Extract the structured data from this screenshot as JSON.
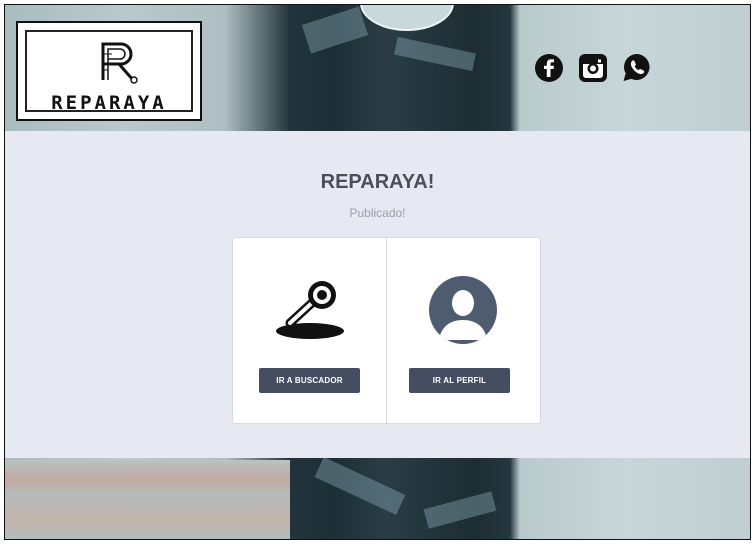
{
  "brand": {
    "logo_text": "REPARAYA"
  },
  "social": [
    {
      "name": "facebook-icon",
      "glyph": "f"
    },
    {
      "name": "instagram-icon",
      "glyph": ""
    },
    {
      "name": "whatsapp-icon",
      "glyph": ""
    }
  ],
  "main": {
    "title": "REPARAYA!",
    "subtitle": "Publicado!"
  },
  "cards": {
    "search_button": "IR A BUSCADOR",
    "profile_button": "IR AL PERFIL"
  },
  "colors": {
    "panel_bg": "#e7e9f2",
    "button_bg": "#454e60",
    "title_text": "#4b4f5b",
    "avatar": "#4f5b6f"
  }
}
